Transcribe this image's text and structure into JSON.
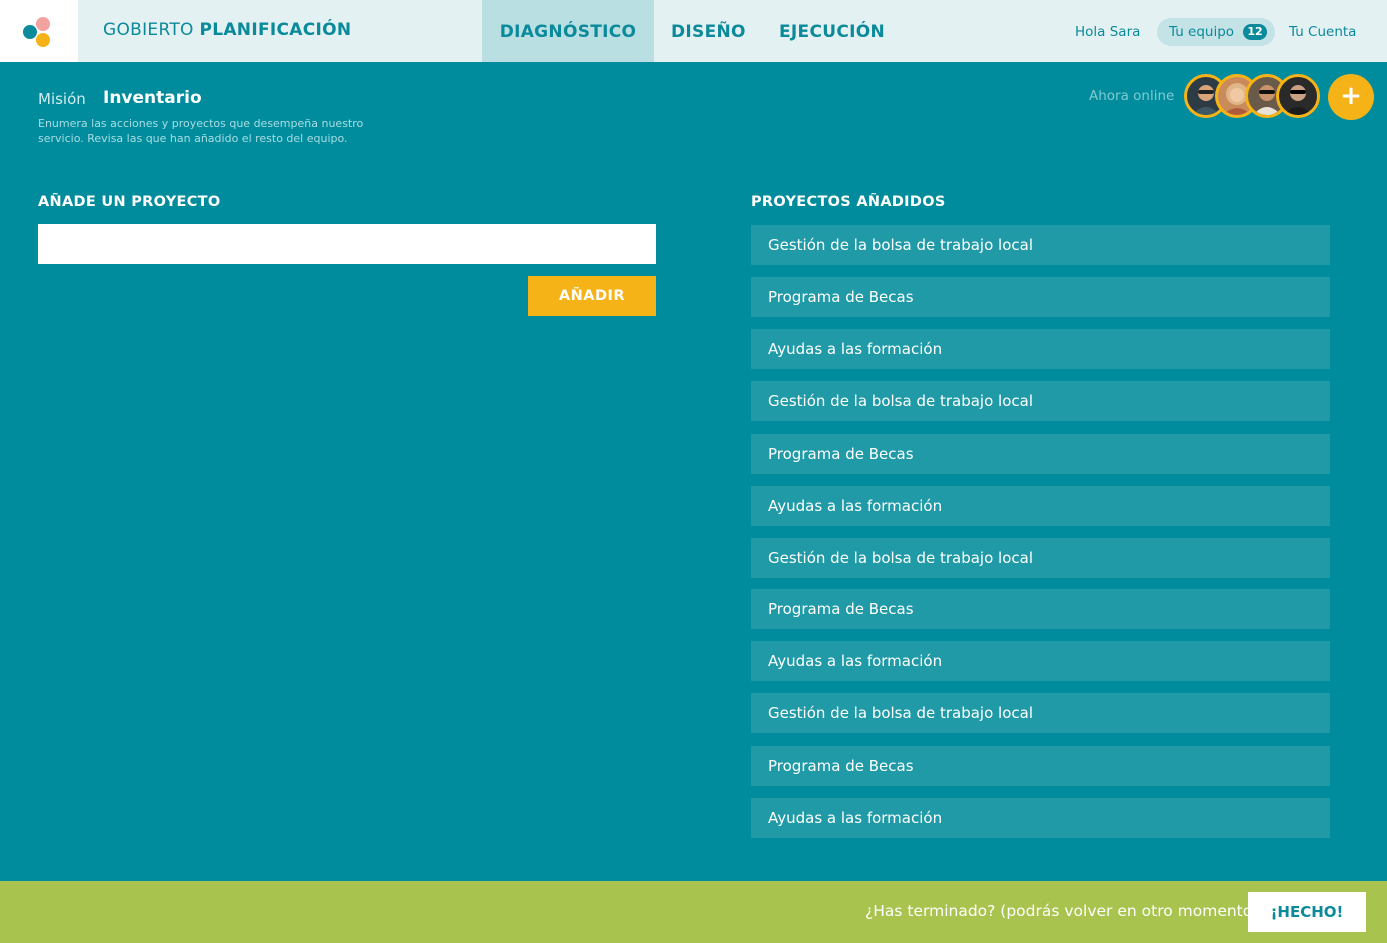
{
  "header": {
    "brand_light": "GOBIERTO",
    "brand_bold": "PLANIFICACIÓN",
    "tabs": [
      {
        "label": "DIAGNÓSTICO",
        "active": true
      },
      {
        "label": "DISEÑO",
        "active": false
      },
      {
        "label": "EJECUCIÓN",
        "active": false
      }
    ],
    "greeting": "Hola Sara",
    "team_label": "Tu equipo",
    "team_count": "12",
    "account_label": "Tu Cuenta"
  },
  "subheader": {
    "crumb_parent": "Misión",
    "crumb_current": "Inventario",
    "description": "Enumera las acciones y proyectos que desempeña nuestro servicio. Revisa las que han añadido el resto del equipo.",
    "online_label": "Ahora online",
    "add_member_icon": "+"
  },
  "form": {
    "title": "AÑADE UN PROYECTO",
    "input_value": "",
    "input_placeholder": "",
    "add_label": "AÑADIR"
  },
  "list": {
    "title": "PROYECTOS AÑADIDOS",
    "items": [
      "Gestión de la bolsa de trabajo local",
      "Programa de Becas",
      "Ayudas a las formación",
      "Gestión de la bolsa de trabajo local",
      "Programa de Becas",
      "Ayudas a las formación",
      "Gestión de la bolsa de trabajo local",
      "Programa de Becas",
      "Ayudas a las formación",
      "Gestión de la bolsa de trabajo local",
      "Programa de Becas",
      "Ayudas a las formación"
    ]
  },
  "footer": {
    "question": "¿Has terminado? (podrás volver en otro momento)",
    "done_label": "¡HECHO!"
  },
  "colors": {
    "background": "#008c9c",
    "accent": "#f6b318",
    "footer": "#a8c34e",
    "list_item": "#1f9aa6"
  }
}
